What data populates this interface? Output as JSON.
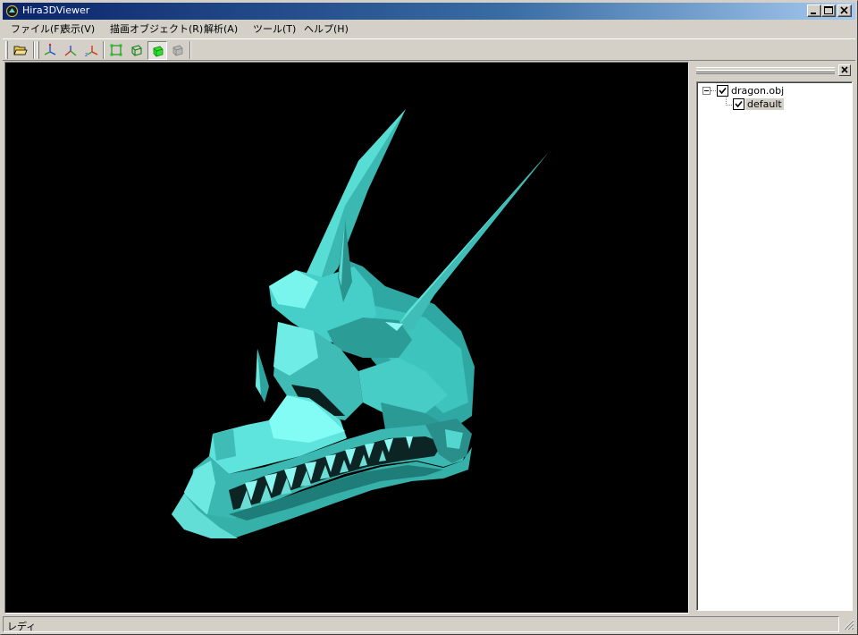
{
  "window": {
    "title": "Hira3DViewer"
  },
  "menu": [
    {
      "label": "ファイル(F)"
    },
    {
      "label": "表示(V)"
    },
    {
      "label": "描画オブジェクト(R)"
    },
    {
      "label": "解析(A)"
    },
    {
      "label": "ツール(T)"
    },
    {
      "label": "ヘルプ(H)"
    }
  ],
  "toolbar": {
    "buttons": [
      {
        "icon": "open-folder-icon"
      },
      {
        "icon": "axis-x-icon",
        "axis": "x"
      },
      {
        "icon": "axis-y-icon",
        "axis": "y"
      },
      {
        "icon": "axis-z-icon",
        "axis": "z"
      },
      {
        "icon": "vertex-mode-icon"
      },
      {
        "icon": "wireframe-mode-icon"
      },
      {
        "icon": "solid-mode-icon",
        "pressed": true
      },
      {
        "icon": "texture-mode-icon",
        "disabled": true
      }
    ]
  },
  "viewport": {
    "background": "#000000",
    "model_color": "#4ee8df"
  },
  "tree": {
    "root": {
      "label": "dragon.obj",
      "checked": true,
      "expanded": true
    },
    "children": [
      {
        "label": "default",
        "checked": true,
        "selected": true
      }
    ]
  },
  "status": {
    "text": "レディ"
  }
}
